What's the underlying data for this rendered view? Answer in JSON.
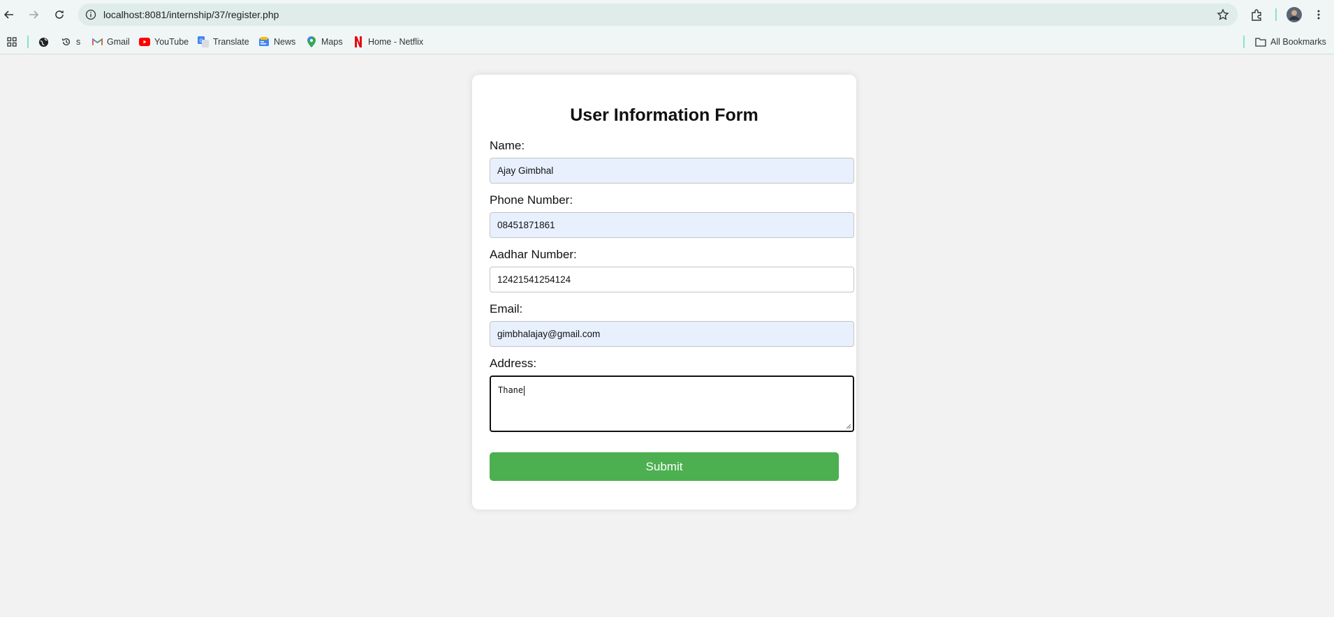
{
  "browser": {
    "url": "localhost:8081/internship/37/register.php",
    "bookmarks": [
      {
        "label": "",
        "icon": "globe-icon"
      },
      {
        "label": "s",
        "icon": "history-icon"
      },
      {
        "label": "Gmail",
        "icon": "gmail-icon"
      },
      {
        "label": "YouTube",
        "icon": "youtube-icon"
      },
      {
        "label": "Translate",
        "icon": "translate-icon"
      },
      {
        "label": "News",
        "icon": "news-icon"
      },
      {
        "label": "Maps",
        "icon": "maps-icon"
      },
      {
        "label": "Home - Netflix",
        "icon": "netflix-icon"
      }
    ],
    "all_bookmarks_label": "All Bookmarks"
  },
  "form": {
    "title": "User Information Form",
    "name_label": "Name:",
    "name_value": "Ajay Gimbhal",
    "phone_label": "Phone Number:",
    "phone_value": "08451871861",
    "aadhar_label": "Aadhar Number:",
    "aadhar_value": "12421541254124",
    "email_label": "Email:",
    "email_value": "gimbhalajay@gmail.com",
    "address_label": "Address:",
    "address_value": "Thane",
    "submit_label": "Submit"
  },
  "colors": {
    "submit": "#4caf50",
    "autofill": "#e8f0fe",
    "page_bg": "#f2f2f2"
  }
}
